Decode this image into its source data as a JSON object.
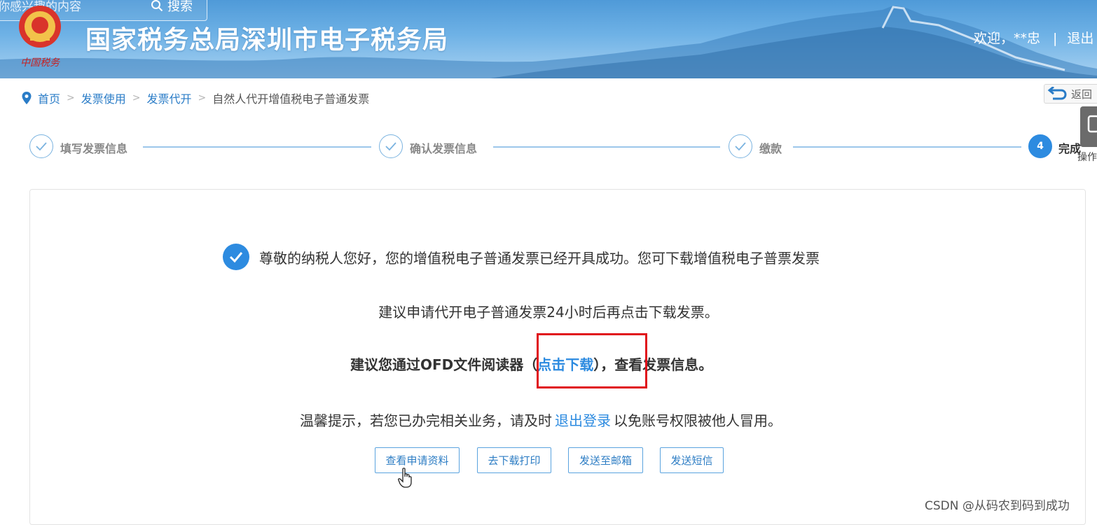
{
  "header": {
    "search_placeholder": "你感兴趣的内容",
    "search_button": "搜索",
    "site_title": "国家税务总局深圳市电子税务局",
    "emblem_caption": "中国税务",
    "welcome": "欢迎，**忠",
    "separator": "|",
    "logout": "退出"
  },
  "breadcrumb": {
    "items": [
      "首页",
      "发票使用",
      "发票代开"
    ],
    "current": "自然人代开增值税电子普通发票",
    "separator": ">"
  },
  "back_button": "返回",
  "side_tool": {
    "label": "操作"
  },
  "steps": [
    {
      "label": "填写发票信息",
      "status": "done"
    },
    {
      "label": "确认发票信息",
      "status": "done"
    },
    {
      "label": "缴款",
      "status": "done"
    },
    {
      "label": "完成",
      "number": "4",
      "status": "active"
    }
  ],
  "result": {
    "success_message": "尊敬的纳税人您好，您的增值税电子普通发票已经开具成功。您可下载增值税电子普票发票",
    "suggest_line": "建议申请代开电子普通发票24小时后再点击下载发票。",
    "ofd_prefix": "建议您通过OFD文件阅读器（",
    "ofd_link": "点击下载",
    "ofd_suffix": "），查看发票信息。",
    "tip_prefix": "温馨提示，若您已办完相关业务，请及时",
    "tip_link": "退出登录",
    "tip_suffix": "以免账号权限被他人冒用。"
  },
  "actions": {
    "view_application": "查看申请资料",
    "download_print": "去下载打印",
    "send_email": "发送至邮箱",
    "send_sms": "发送短信"
  },
  "watermark": "CSDN @从码农到码到成功",
  "colors": {
    "primary_blue": "#2d8be0",
    "highlight_red": "#e0121b"
  }
}
